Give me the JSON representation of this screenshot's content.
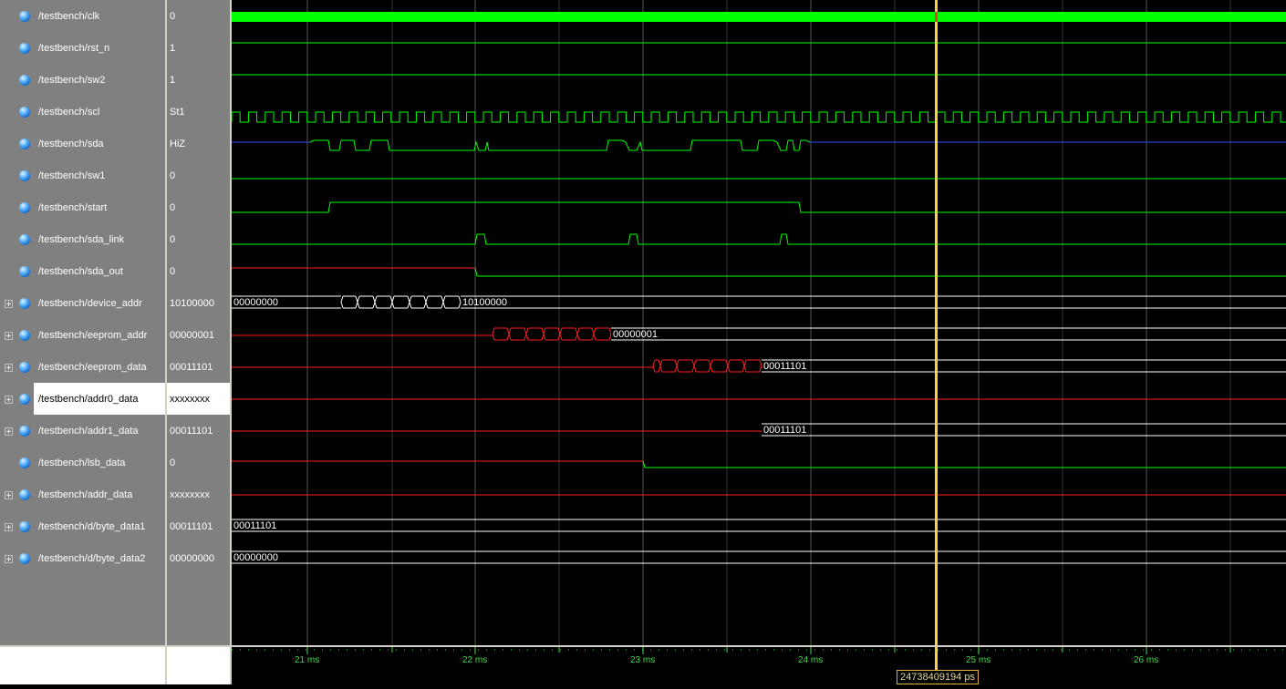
{
  "signals": [
    {
      "name": "/testbench/clk",
      "value": "0",
      "expandable": false
    },
    {
      "name": "/testbench/rst_n",
      "value": "1",
      "expandable": false
    },
    {
      "name": "/testbench/sw2",
      "value": "1",
      "expandable": false
    },
    {
      "name": "/testbench/scl",
      "value": "St1",
      "expandable": false
    },
    {
      "name": "/testbench/sda",
      "value": "HiZ",
      "expandable": false
    },
    {
      "name": "/testbench/sw1",
      "value": "0",
      "expandable": false
    },
    {
      "name": "/testbench/start",
      "value": "0",
      "expandable": false
    },
    {
      "name": "/testbench/sda_link",
      "value": "0",
      "expandable": false
    },
    {
      "name": "/testbench/sda_out",
      "value": "0",
      "expandable": false
    },
    {
      "name": "/testbench/device_addr",
      "value": "10100000",
      "expandable": true
    },
    {
      "name": "/testbench/eeprom_addr",
      "value": "00000001",
      "expandable": true
    },
    {
      "name": "/testbench/eeprom_data",
      "value": "00011101",
      "expandable": true
    },
    {
      "name": "/testbench/addr0_data",
      "value": "xxxxxxxx",
      "expandable": true,
      "selected": true
    },
    {
      "name": "/testbench/addr1_data",
      "value": "00011101",
      "expandable": true
    },
    {
      "name": "/testbench/lsb_data",
      "value": "0",
      "expandable": false
    },
    {
      "name": "/testbench/addr_data",
      "value": "xxxxxxxx",
      "expandable": true
    },
    {
      "name": "/testbench/d/byte_data1",
      "value": "00011101",
      "expandable": true
    },
    {
      "name": "/testbench/d/byte_data2",
      "value": "00000000",
      "expandable": true
    }
  ],
  "bus_labels": {
    "device_addr_start": "00000000",
    "device_addr_end": "10100000",
    "eeprom_addr_end": "00000001",
    "eeprom_data_end": "00011101",
    "addr1_data_end": "00011101",
    "byte_data1": "00011101",
    "byte_data2": "00000000"
  },
  "timeline": {
    "ticks": [
      "21 ms",
      "22 ms",
      "23 ms",
      "24 ms",
      "25 ms",
      "26 ms"
    ],
    "cursor_time": "24738409194 ps"
  },
  "colors": {
    "wave_green": "#00ff00",
    "wave_red": "#ff2020",
    "wave_blue": "#3050ff",
    "cursor": "#ffd040",
    "grid": "#606060"
  }
}
